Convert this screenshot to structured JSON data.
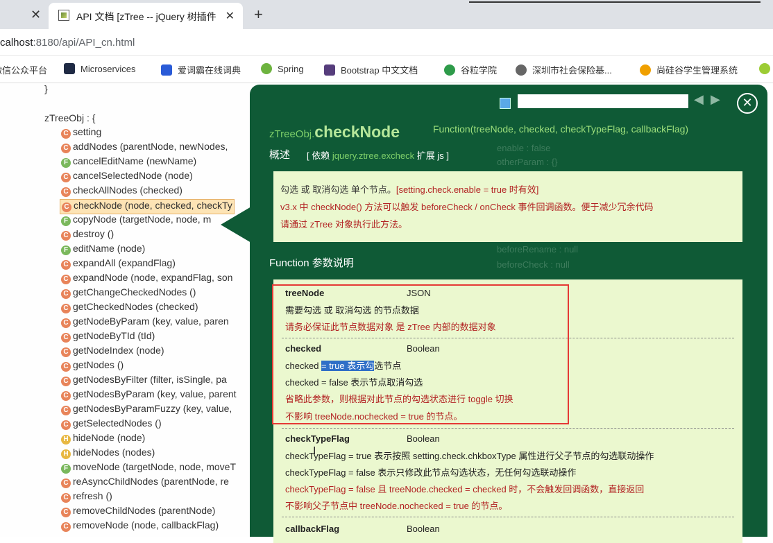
{
  "browser": {
    "tab_title": "API 文档 [zTree -- jQuery 树插件",
    "tab_close_left": "✕",
    "tab_close": "✕",
    "new_tab": "+",
    "url_host": "calhost",
    "url_rest": ":8180/api/API_cn.html"
  },
  "bookmarks": [
    {
      "label": "微信公众平台",
      "color": "#0aa04a"
    },
    {
      "label": "Microservices",
      "color": "#1f2a44"
    },
    {
      "label": "爱词霸在线词典",
      "color": "#2a5bd7"
    },
    {
      "label": "Spring",
      "color": "#6db33f"
    },
    {
      "label": "Bootstrap 中文文档",
      "color": "#563d7c"
    },
    {
      "label": "谷粒学院",
      "color": "#2e9b4a"
    },
    {
      "label": "深圳市社会保险基...",
      "color": "#666666"
    },
    {
      "label": "尚硅谷学生管理系统",
      "color": "#f0a000"
    }
  ],
  "tree": {
    "brace": "}",
    "root": "zTreeObj : {",
    "nodes": [
      {
        "label": "setting",
        "icon": "C"
      },
      {
        "label": "addNodes (parentNode, newNodes, ",
        "icon": "C"
      },
      {
        "label": "cancelEditName (newName)",
        "icon": "F"
      },
      {
        "label": "cancelSelectedNode (node)",
        "icon": "C"
      },
      {
        "label": "checkAllNodes (checked)",
        "icon": "C"
      },
      {
        "label": "checkNode (node, checked, checkTy",
        "icon": "C"
      },
      {
        "label": "copyNode (targetNode, node, m",
        "icon": "F"
      },
      {
        "label": "destroy ()",
        "icon": "C"
      },
      {
        "label": "editName (node)",
        "icon": "F"
      },
      {
        "label": "expandAll (expandFlag)",
        "icon": "C"
      },
      {
        "label": "expandNode (node, expandFlag, son",
        "icon": "C"
      },
      {
        "label": "getChangeCheckedNodes ()",
        "icon": "C"
      },
      {
        "label": "getCheckedNodes (checked)",
        "icon": "C"
      },
      {
        "label": "getNodeByParam (key, value, paren",
        "icon": "C"
      },
      {
        "label": "getNodeByTId (tId)",
        "icon": "C"
      },
      {
        "label": "getNodeIndex (node)",
        "icon": "C"
      },
      {
        "label": "getNodes ()",
        "icon": "C"
      },
      {
        "label": "getNodesByFilter (filter, isSingle, pa",
        "icon": "C"
      },
      {
        "label": "getNodesByParam (key, value, parent",
        "icon": "C"
      },
      {
        "label": "getNodesByParamFuzzy (key, value, ",
        "icon": "C"
      },
      {
        "label": "getSelectedNodes ()",
        "icon": "C"
      },
      {
        "label": "hideNode (node)",
        "icon": "H"
      },
      {
        "label": "hideNodes (nodes)",
        "icon": "H"
      },
      {
        "label": "moveNode (targetNode, node, moveT",
        "icon": "F"
      },
      {
        "label": "reAsyncChildNodes (parentNode, re",
        "icon": "C"
      },
      {
        "label": "refresh ()",
        "icon": "C"
      },
      {
        "label": "removeChildNodes (parentNode)",
        "icon": "C"
      },
      {
        "label": "removeNode (node, callbackFlag)",
        "icon": "C"
      }
    ]
  },
  "panel": {
    "nav_prev": "◀",
    "nav_next": "▶",
    "close": "✕",
    "fn_prefix": "zTreeObj.",
    "fn_name": "checkNode",
    "fn_signature": "Function(treeNode, checked, checkTypeFlag, callbackFlag)",
    "overview": "概述",
    "depends_pre": "[ 依赖 ",
    "depends_pkg": "jquery.ztree.excheck",
    "depends_post": " 扩展 js ]",
    "ghost_1": "enable : false",
    "ghost_2": "otherParam : {}",
    "ghost_3": "beforeRename : null",
    "ghost_4": "beforeCheck : null",
    "desc_1a": "勾选 或 取消勾选 单个节点。",
    "desc_1b": "[setting.check.enable = true 时有效]",
    "desc_2": "v3.x 中 checkNode() 方法可以触发 beforeCheck / onCheck 事件回调函数。便于减少冗余代码",
    "desc_3": "请通过 zTree 对象执行此方法。",
    "params_title": "Function 参数说明",
    "params": {
      "p1_name": "treeNode",
      "p1_type": "JSON",
      "p1_l1": "需要勾选 或 取消勾选 的节点数据",
      "p1_l2": "请务必保证此节点数据对象 是 zTree 内部的数据对象",
      "p2_name": "checked",
      "p2_type": "Boolean",
      "p2_l1_a": "checked ",
      "p2_l1_sel": "= true 表示勾",
      "p2_l1_b": "选节点",
      "p2_l2": "checked = false 表示节点取消勾选",
      "p2_l3": "省略此参数，则根据对此节点的勾选状态进行 toggle 切换",
      "p2_l4": "不影响 treeNode.nochecked = true 的节点。",
      "p3_name": "checkTypeFlag",
      "p3_type": "Boolean",
      "p3_l1": "checkTypeFlag = true 表示按照 setting.check.chkboxType 属性进行父子节点的勾选联动操作",
      "p3_l2": "checkTypeFlag = false 表示只修改此节点勾选状态，无任何勾选联动操作",
      "p3_l3": "checkTypeFlag = false 且 treeNode.checked = checked 时，不会触发回调函数，直接返回",
      "p3_l4": "不影响父子节点中 treeNode.nochecked = true 的节点。",
      "p4_name": "callbackFlag",
      "p4_type": "Boolean"
    }
  }
}
